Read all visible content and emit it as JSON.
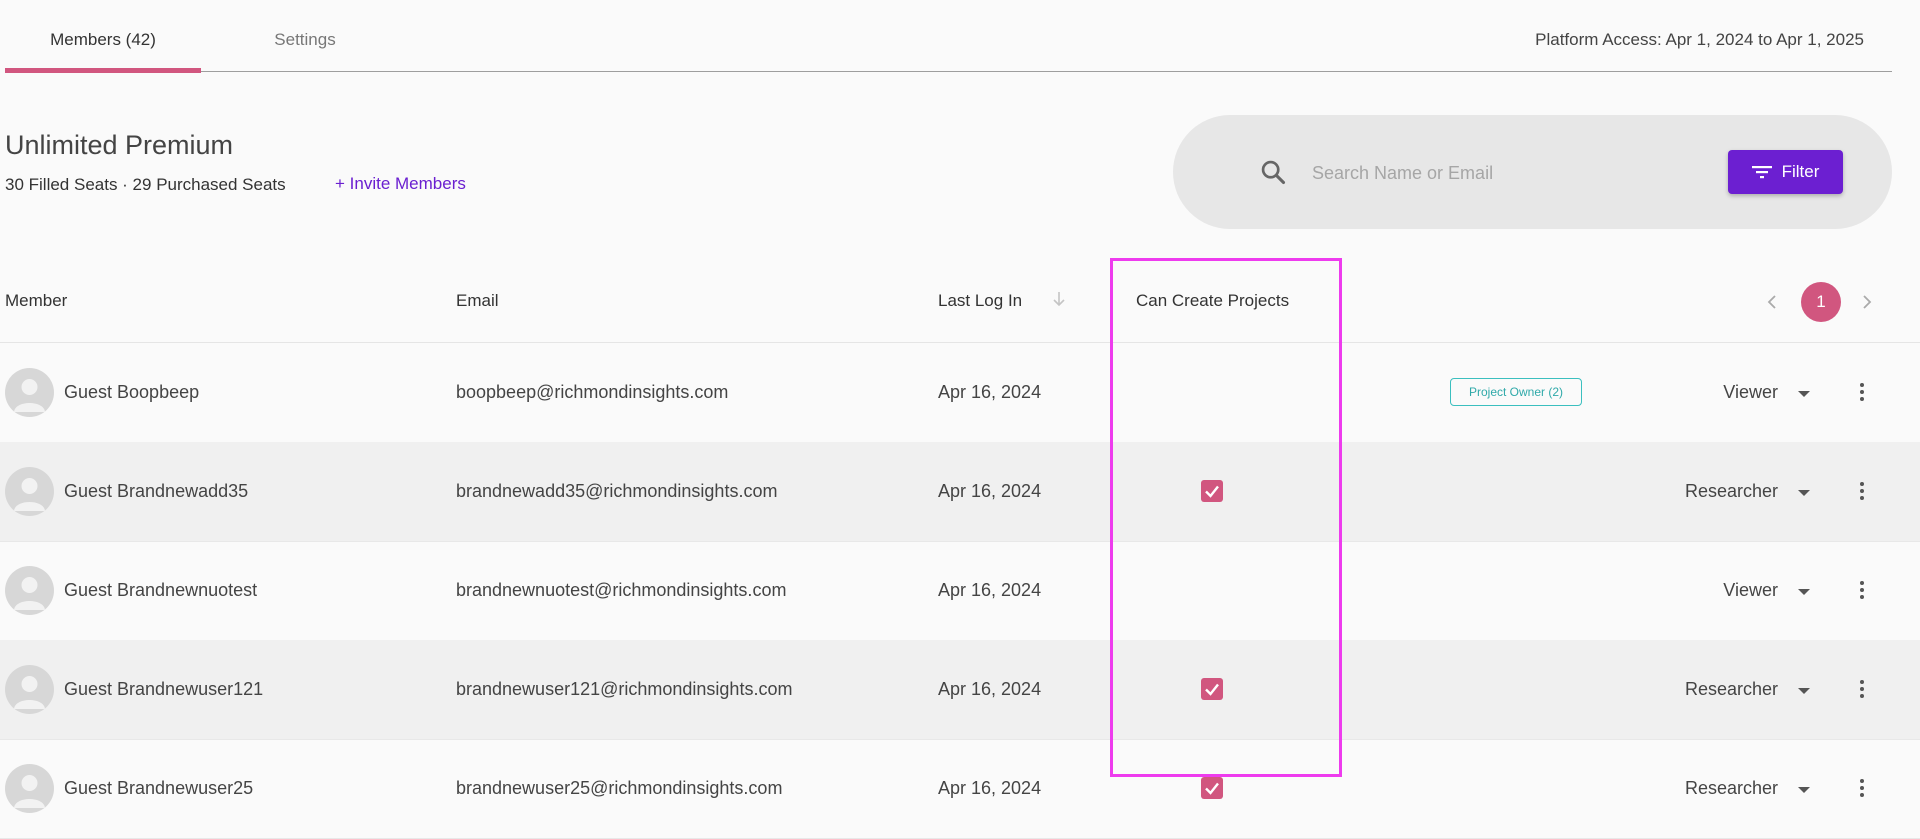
{
  "tabs": {
    "members": "Members (42)",
    "settings": "Settings"
  },
  "platform_access": "Platform Access: Apr 1, 2024 to Apr 1, 2025",
  "plan": {
    "title": "Unlimited Premium",
    "seats": "30 Filled Seats · 29 Purchased Seats",
    "invite": "+ Invite Members"
  },
  "search": {
    "placeholder": "Search Name or Email",
    "filter_label": "Filter"
  },
  "table": {
    "headers": {
      "member": "Member",
      "email": "Email",
      "last_login": "Last Log In",
      "can_create": "Can Create Projects"
    },
    "pagination": {
      "current_page": "1"
    },
    "rows": [
      {
        "name": "Guest Boopbeep",
        "email": "boopbeep@richmondinsights.com",
        "date": "Apr 16, 2024",
        "can_create": false,
        "badge": "Project Owner (2)",
        "role": "Viewer"
      },
      {
        "name": "Guest Brandnewadd35",
        "email": "brandnewadd35@richmondinsights.com",
        "date": "Apr 16, 2024",
        "can_create": true,
        "badge": "",
        "role": "Researcher"
      },
      {
        "name": "Guest Brandnewnuotest",
        "email": "brandnewnuotest@richmondinsights.com",
        "date": "Apr 16, 2024",
        "can_create": false,
        "badge": "",
        "role": "Viewer"
      },
      {
        "name": "Guest Brandnewuser121",
        "email": "brandnewuser121@richmondinsights.com",
        "date": "Apr 16, 2024",
        "can_create": true,
        "badge": "",
        "role": "Researcher"
      },
      {
        "name": "Guest Brandnewuser25",
        "email": "brandnewuser25@richmondinsights.com",
        "date": "Apr 16, 2024",
        "can_create": true,
        "badge": "",
        "role": "Researcher"
      }
    ]
  },
  "colors": {
    "accent_pink": "#d1567f",
    "accent_purple": "#6c1fd1",
    "badge_teal": "#2fa9a9",
    "highlight_magenta": "#ee3bee"
  },
  "icons": {
    "search": "search-icon",
    "filter": "filter-icon",
    "sort": "arrow-down-icon",
    "prev": "chevron-left-icon",
    "next": "chevron-right-icon",
    "caret": "caret-down-icon",
    "more": "more-vertical-icon",
    "avatar": "user-silhouette-icon",
    "check": "check-icon"
  }
}
